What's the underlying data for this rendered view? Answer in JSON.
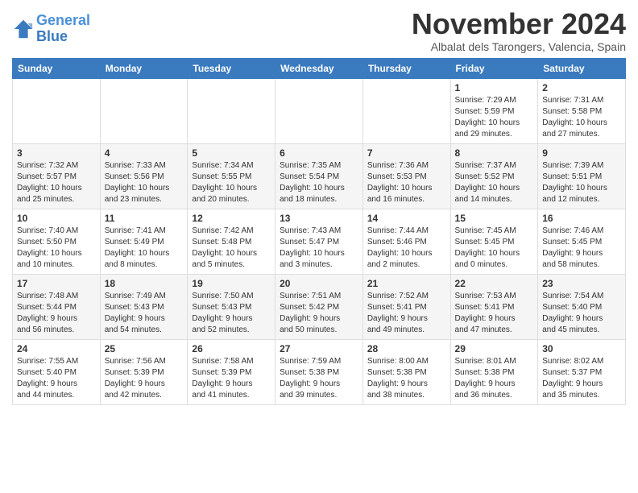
{
  "header": {
    "logo_line1": "General",
    "logo_line2": "Blue",
    "month_title": "November 2024",
    "location": "Albalat dels Tarongers, Valencia, Spain"
  },
  "weekdays": [
    "Sunday",
    "Monday",
    "Tuesday",
    "Wednesday",
    "Thursday",
    "Friday",
    "Saturday"
  ],
  "weeks": [
    [
      {
        "day": "",
        "info": ""
      },
      {
        "day": "",
        "info": ""
      },
      {
        "day": "",
        "info": ""
      },
      {
        "day": "",
        "info": ""
      },
      {
        "day": "",
        "info": ""
      },
      {
        "day": "1",
        "info": "Sunrise: 7:29 AM\nSunset: 5:59 PM\nDaylight: 10 hours\nand 29 minutes."
      },
      {
        "day": "2",
        "info": "Sunrise: 7:31 AM\nSunset: 5:58 PM\nDaylight: 10 hours\nand 27 minutes."
      }
    ],
    [
      {
        "day": "3",
        "info": "Sunrise: 7:32 AM\nSunset: 5:57 PM\nDaylight: 10 hours\nand 25 minutes."
      },
      {
        "day": "4",
        "info": "Sunrise: 7:33 AM\nSunset: 5:56 PM\nDaylight: 10 hours\nand 23 minutes."
      },
      {
        "day": "5",
        "info": "Sunrise: 7:34 AM\nSunset: 5:55 PM\nDaylight: 10 hours\nand 20 minutes."
      },
      {
        "day": "6",
        "info": "Sunrise: 7:35 AM\nSunset: 5:54 PM\nDaylight: 10 hours\nand 18 minutes."
      },
      {
        "day": "7",
        "info": "Sunrise: 7:36 AM\nSunset: 5:53 PM\nDaylight: 10 hours\nand 16 minutes."
      },
      {
        "day": "8",
        "info": "Sunrise: 7:37 AM\nSunset: 5:52 PM\nDaylight: 10 hours\nand 14 minutes."
      },
      {
        "day": "9",
        "info": "Sunrise: 7:39 AM\nSunset: 5:51 PM\nDaylight: 10 hours\nand 12 minutes."
      }
    ],
    [
      {
        "day": "10",
        "info": "Sunrise: 7:40 AM\nSunset: 5:50 PM\nDaylight: 10 hours\nand 10 minutes."
      },
      {
        "day": "11",
        "info": "Sunrise: 7:41 AM\nSunset: 5:49 PM\nDaylight: 10 hours\nand 8 minutes."
      },
      {
        "day": "12",
        "info": "Sunrise: 7:42 AM\nSunset: 5:48 PM\nDaylight: 10 hours\nand 5 minutes."
      },
      {
        "day": "13",
        "info": "Sunrise: 7:43 AM\nSunset: 5:47 PM\nDaylight: 10 hours\nand 3 minutes."
      },
      {
        "day": "14",
        "info": "Sunrise: 7:44 AM\nSunset: 5:46 PM\nDaylight: 10 hours\nand 2 minutes."
      },
      {
        "day": "15",
        "info": "Sunrise: 7:45 AM\nSunset: 5:45 PM\nDaylight: 10 hours\nand 0 minutes."
      },
      {
        "day": "16",
        "info": "Sunrise: 7:46 AM\nSunset: 5:45 PM\nDaylight: 9 hours\nand 58 minutes."
      }
    ],
    [
      {
        "day": "17",
        "info": "Sunrise: 7:48 AM\nSunset: 5:44 PM\nDaylight: 9 hours\nand 56 minutes."
      },
      {
        "day": "18",
        "info": "Sunrise: 7:49 AM\nSunset: 5:43 PM\nDaylight: 9 hours\nand 54 minutes."
      },
      {
        "day": "19",
        "info": "Sunrise: 7:50 AM\nSunset: 5:43 PM\nDaylight: 9 hours\nand 52 minutes."
      },
      {
        "day": "20",
        "info": "Sunrise: 7:51 AM\nSunset: 5:42 PM\nDaylight: 9 hours\nand 50 minutes."
      },
      {
        "day": "21",
        "info": "Sunrise: 7:52 AM\nSunset: 5:41 PM\nDaylight: 9 hours\nand 49 minutes."
      },
      {
        "day": "22",
        "info": "Sunrise: 7:53 AM\nSunset: 5:41 PM\nDaylight: 9 hours\nand 47 minutes."
      },
      {
        "day": "23",
        "info": "Sunrise: 7:54 AM\nSunset: 5:40 PM\nDaylight: 9 hours\nand 45 minutes."
      }
    ],
    [
      {
        "day": "24",
        "info": "Sunrise: 7:55 AM\nSunset: 5:40 PM\nDaylight: 9 hours\nand 44 minutes."
      },
      {
        "day": "25",
        "info": "Sunrise: 7:56 AM\nSunset: 5:39 PM\nDaylight: 9 hours\nand 42 minutes."
      },
      {
        "day": "26",
        "info": "Sunrise: 7:58 AM\nSunset: 5:39 PM\nDaylight: 9 hours\nand 41 minutes."
      },
      {
        "day": "27",
        "info": "Sunrise: 7:59 AM\nSunset: 5:38 PM\nDaylight: 9 hours\nand 39 minutes."
      },
      {
        "day": "28",
        "info": "Sunrise: 8:00 AM\nSunset: 5:38 PM\nDaylight: 9 hours\nand 38 minutes."
      },
      {
        "day": "29",
        "info": "Sunrise: 8:01 AM\nSunset: 5:38 PM\nDaylight: 9 hours\nand 36 minutes."
      },
      {
        "day": "30",
        "info": "Sunrise: 8:02 AM\nSunset: 5:37 PM\nDaylight: 9 hours\nand 35 minutes."
      }
    ]
  ]
}
